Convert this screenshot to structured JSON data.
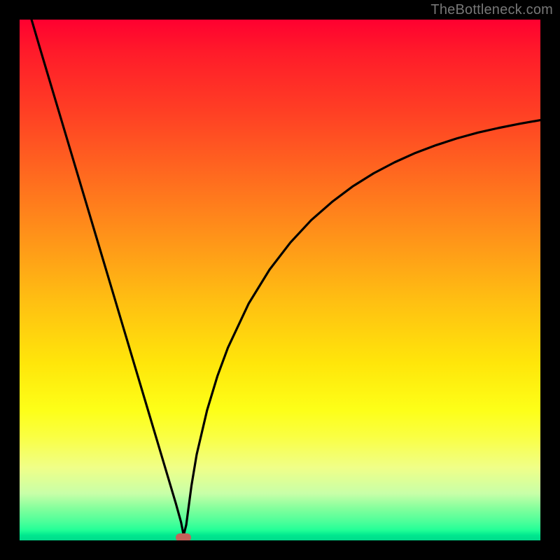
{
  "watermark": "TheBottleneck.com",
  "colors": {
    "frame": "#000000",
    "curve_stroke": "#000000",
    "dot_fill": "#c4635a",
    "watermark_text": "#777777"
  },
  "chart_data": {
    "type": "line",
    "title": "",
    "xlabel": "",
    "ylabel": "",
    "xlim": [
      0,
      100
    ],
    "ylim": [
      0,
      100
    ],
    "gradient_stops": [
      {
        "pos": 0,
        "color": "#ff0030"
      },
      {
        "pos": 18,
        "color": "#ff4024"
      },
      {
        "pos": 42,
        "color": "#ff9419"
      },
      {
        "pos": 66,
        "color": "#ffe60a"
      },
      {
        "pos": 86,
        "color": "#f0ff88"
      },
      {
        "pos": 96,
        "color": "#4aff9a"
      },
      {
        "pos": 100,
        "color": "#00db8b"
      }
    ],
    "series": [
      {
        "name": "curve",
        "x": [
          0,
          2,
          4,
          6,
          8,
          10,
          12,
          14,
          16,
          18,
          20,
          22,
          24,
          26,
          28,
          30,
          31,
          31.5,
          32,
          33,
          34,
          36,
          38,
          40,
          44,
          48,
          52,
          56,
          60,
          64,
          68,
          72,
          76,
          80,
          84,
          88,
          92,
          96,
          100
        ],
        "y": [
          108,
          101,
          94.2,
          87.5,
          80.8,
          74.1,
          67.4,
          60.7,
          54,
          47.3,
          40.6,
          33.9,
          27.2,
          20.5,
          13.8,
          7.1,
          3.5,
          1.0,
          3.0,
          10.5,
          16.5,
          25.0,
          31.6,
          37.0,
          45.5,
          52.0,
          57.2,
          61.5,
          65.0,
          68.0,
          70.5,
          72.6,
          74.4,
          75.9,
          77.2,
          78.3,
          79.2,
          80.0,
          80.7
        ]
      }
    ],
    "marker": {
      "x": 31.4,
      "y": 0.6
    }
  }
}
